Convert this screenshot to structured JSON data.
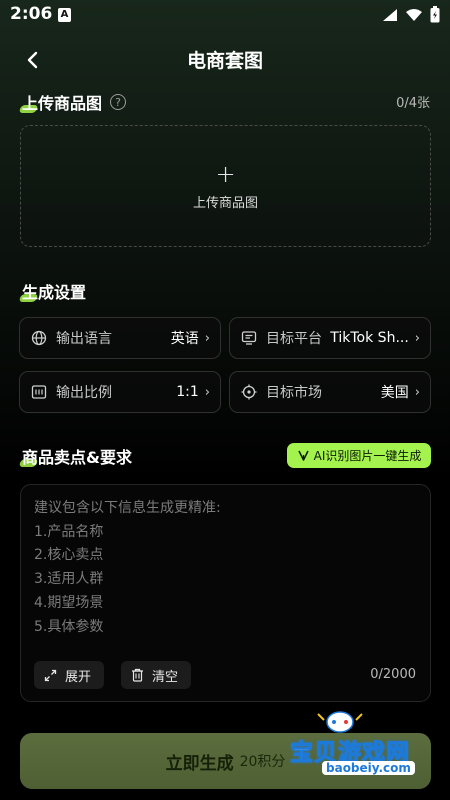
{
  "status_bar": {
    "time": "2:06",
    "notification": "A"
  },
  "header": {
    "title": "电商套图"
  },
  "upload": {
    "title": "上传商品图",
    "count": "0/4张",
    "label": "上传商品图"
  },
  "settings": {
    "title": "生成设置",
    "items": [
      {
        "label": "输出语言",
        "value": "英语",
        "icon": "globe-icon"
      },
      {
        "label": "目标平台",
        "value": "TikTok Sh...",
        "icon": "monitor-icon"
      },
      {
        "label": "输出比例",
        "value": "1:1",
        "icon": "ratio-icon"
      },
      {
        "label": "目标市场",
        "value": "美国",
        "icon": "target-icon"
      }
    ]
  },
  "selling": {
    "title": "商品卖点&要求",
    "ai_button": "AI识别图片一键生成",
    "placeholder": "建议包含以下信息生成更精准:\n1.产品名称\n2.核心卖点\n3.适用人群\n4.期望场景\n5.具体参数",
    "expand_label": "展开",
    "clear_label": "清空",
    "counter": "0/2000"
  },
  "submit": {
    "label": "立即生成",
    "cost": "20积分"
  },
  "watermark": {
    "text": "宝贝游戏网",
    "url": "baobeiy.com"
  },
  "colors": {
    "accent": "#a3f24d",
    "button": "#56673a",
    "watermark": "#1e7ad9"
  }
}
